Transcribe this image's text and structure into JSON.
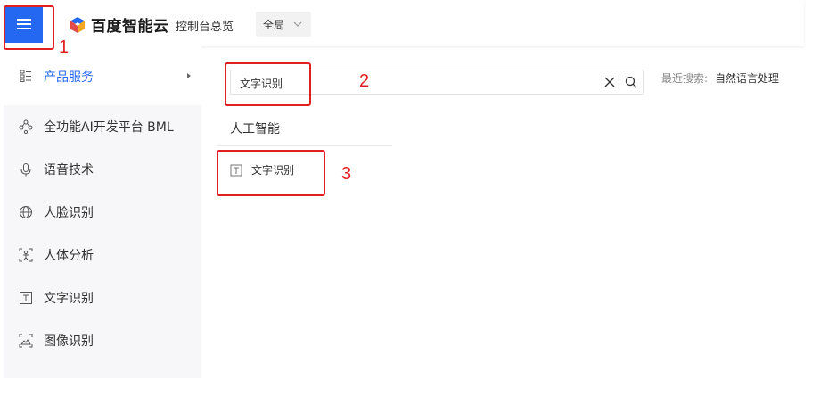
{
  "header": {
    "brand": "百度智能云",
    "console_link": "控制台总览",
    "region_value": "全局"
  },
  "sidebar": {
    "products": "产品服务",
    "items": [
      {
        "label": "全功能AI开发平台 BML",
        "icon": "nodes-icon"
      },
      {
        "label": "语音技术",
        "icon": "microphone-icon"
      },
      {
        "label": "人脸识别",
        "icon": "globe-icon"
      },
      {
        "label": "人体分析",
        "icon": "body-scan-icon"
      },
      {
        "label": "文字识别",
        "icon": "text-icon"
      },
      {
        "label": "图像识别",
        "icon": "image-scan-icon"
      }
    ]
  },
  "search": {
    "value": "文字识别",
    "recent_label": "最近搜索:",
    "recent_value": "自然语言处理"
  },
  "results": {
    "category": "人工智能",
    "item": "文字识别"
  },
  "annotations": [
    "1",
    "2",
    "3"
  ],
  "colors": {
    "accent": "#2468f2",
    "annotation": "#e02020"
  }
}
